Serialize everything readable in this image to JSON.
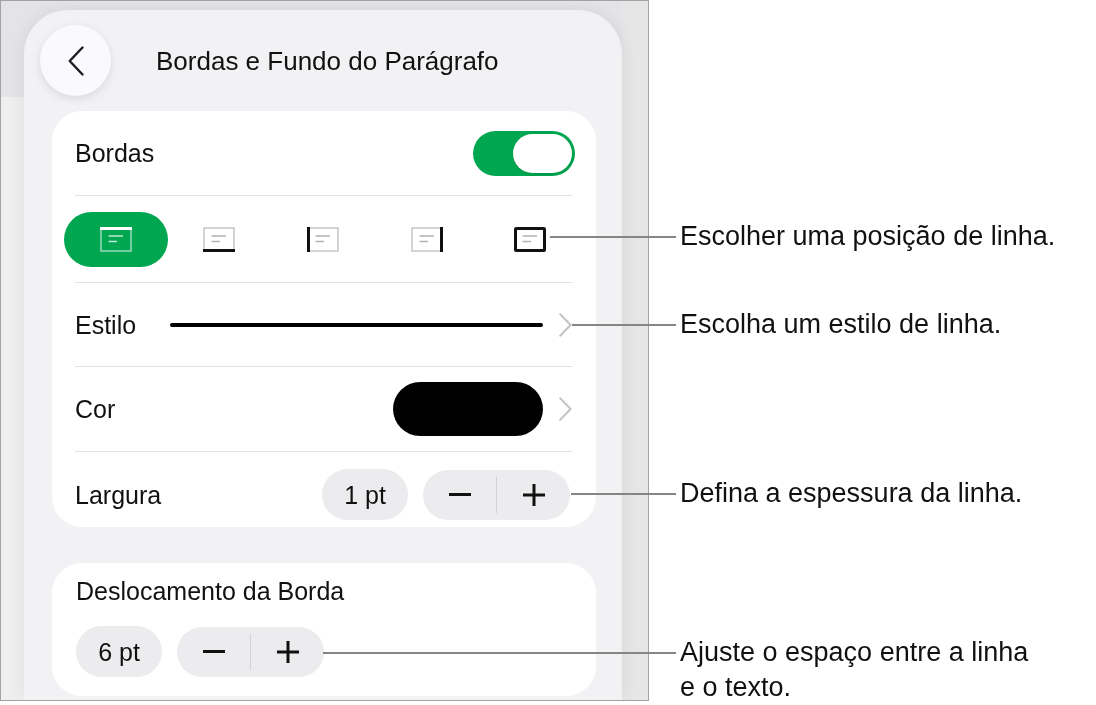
{
  "panel": {
    "title": "Bordas e Fundo do Parágrafo",
    "borders": {
      "label": "Bordas",
      "on": true,
      "positions": [
        {
          "kind": "top",
          "selected": true
        },
        {
          "kind": "bottom",
          "selected": false
        },
        {
          "kind": "left",
          "selected": false
        },
        {
          "kind": "right",
          "selected": false
        },
        {
          "kind": "box",
          "selected": false
        }
      ],
      "style": {
        "label": "Estilo"
      },
      "color": {
        "label": "Cor"
      },
      "width": {
        "label": "Largura",
        "value": "1 pt"
      }
    },
    "offset": {
      "label": "Deslocamento da Borda",
      "value": "6 pt"
    }
  },
  "callouts": [
    {
      "text": "Escolher uma posição de linha."
    },
    {
      "text": "Escolha um estilo de linha."
    },
    {
      "text": "Defina a espessura da linha."
    },
    {
      "text": "Ajuste o espaço entre a linha e o texto."
    }
  ]
}
